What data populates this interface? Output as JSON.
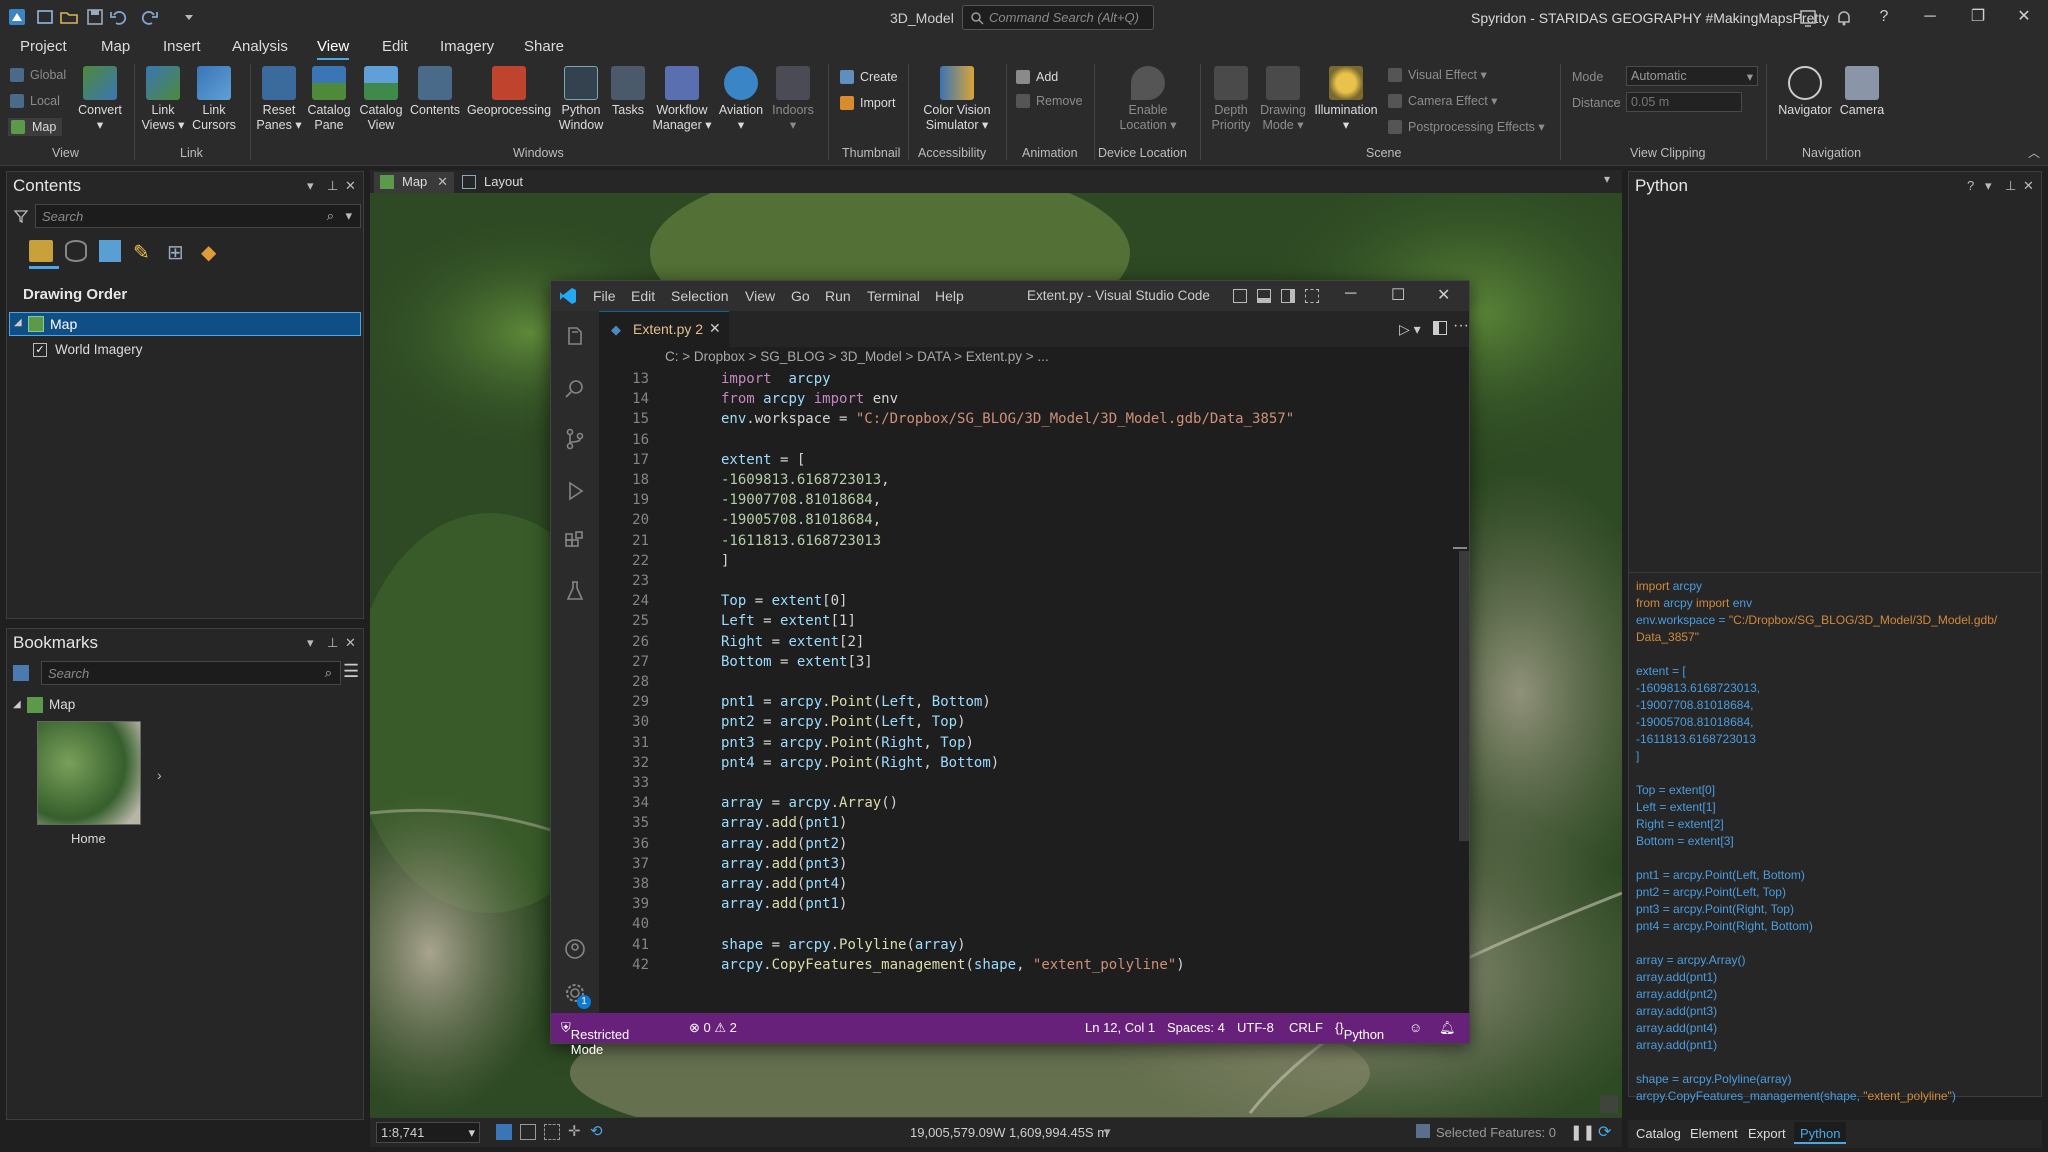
{
  "titlebar": {
    "project": "3D_Model",
    "command_search_placeholder": "Command Search (Alt+Q)",
    "user": "Spyridon - STARIDAS GEOGRAPHY #MakingMapsPretty"
  },
  "ribbon_tabs": [
    "Project",
    "Map",
    "Insert",
    "Analysis",
    "View",
    "Edit",
    "Imagery",
    "Share"
  ],
  "ribbon": {
    "view_group": {
      "global": "Global",
      "local": "Local",
      "map": "Map",
      "convert": "Convert",
      "label": "View"
    },
    "link_group": {
      "link_views": "Link Views",
      "link_cursors": "Link Cursors",
      "label": "Link"
    },
    "windows_group": {
      "reset_panes": "Reset Panes",
      "catalog_pane": "Catalog Pane",
      "catalog_view": "Catalog View",
      "contents": "Contents",
      "geoprocessing": "Geoprocessing",
      "python_window": "Python Window",
      "tasks": "Tasks",
      "workflow_manager": "Workflow Manager",
      "aviation": "Aviation",
      "indoors": "Indoors",
      "label": "Windows"
    },
    "thumbnail_group": {
      "create": "Create",
      "import": "Import",
      "label": "Thumbnail"
    },
    "accessibility_group": {
      "color_vision": "Color Vision Simulator",
      "label": "Accessibility"
    },
    "animation_group": {
      "add": "Add",
      "remove": "Remove",
      "label": "Animation"
    },
    "device_group": {
      "enable_location": "Enable Location",
      "label": "Device Location"
    },
    "scene_group": {
      "depth_priority": "Depth Priority",
      "drawing_mode": "Drawing Mode",
      "illumination": "Illumination",
      "visual_effect": "Visual Effect",
      "camera_effect": "Camera Effect",
      "postprocessing": "Postprocessing Effects",
      "label": "Scene"
    },
    "clipping_group": {
      "mode_label": "Mode",
      "mode_value": "Automatic",
      "distance_label": "Distance",
      "distance_value": "0.05  m",
      "label": "View Clipping"
    },
    "navigation_group": {
      "navigator": "Navigator",
      "camera": "Camera",
      "label": "Navigation"
    }
  },
  "contents": {
    "title": "Contents",
    "search_placeholder": "Search",
    "drawing_order": "Drawing Order",
    "map_item": "Map",
    "layer_item": "World Imagery"
  },
  "bookmarks": {
    "title": "Bookmarks",
    "search_placeholder": "Search",
    "map_item": "Map",
    "bookmark_label": "Home"
  },
  "doc_tabs": [
    "Map",
    "Layout"
  ],
  "vscode": {
    "menu": [
      "File",
      "Edit",
      "Selection",
      "View",
      "Go",
      "Run",
      "Terminal",
      "Help"
    ],
    "title": "Extent.py - Visual Studio Code",
    "tab_label": "Extent.py  2",
    "breadcrumb": "C: > Dropbox > SG_BLOG > 3D_Model > DATA > Extent.py > ...",
    "line_numbers": [
      "13",
      "14",
      "15",
      "16",
      "17",
      "18",
      "19",
      "20",
      "21",
      "22",
      "23",
      "24",
      "25",
      "26",
      "27",
      "28",
      "29",
      "30",
      "31",
      "32",
      "33",
      "34",
      "35",
      "36",
      "37",
      "38",
      "39",
      "40",
      "41",
      "42"
    ],
    "status": {
      "restricted": "Restricted Mode",
      "problems": "⊗ 0 ⚠ 2",
      "position": "Ln 12, Col 1",
      "spaces": "Spaces: 4",
      "encoding": "UTF-8",
      "eol": "CRLF",
      "language": "Python"
    },
    "code_lines": [
      [
        [
          "kw",
          "import"
        ],
        [
          "",
          "  "
        ],
        [
          "va",
          "arcpy"
        ]
      ],
      [
        [
          "kw",
          "from"
        ],
        [
          "",
          " "
        ],
        [
          "va",
          "arcpy"
        ],
        [
          "",
          " "
        ],
        [
          "kw",
          "import"
        ],
        [
          "",
          " env"
        ]
      ],
      [
        [
          "va",
          "env"
        ],
        [
          "",
          ".workspace = "
        ],
        [
          "st",
          "\"C:/Dropbox/SG_BLOG/3D_Model/3D_Model.gdb/Data_3857\""
        ]
      ],
      [],
      [
        [
          "va",
          "extent"
        ],
        [
          "",
          " = ["
        ]
      ],
      [
        [
          "nu",
          "-1609813.6168723013"
        ],
        [
          "",
          ","
        ]
      ],
      [
        [
          "nu",
          "-19007708.81018684"
        ],
        [
          "",
          ","
        ]
      ],
      [
        [
          "nu",
          "-19005708.81018684"
        ],
        [
          "",
          ","
        ]
      ],
      [
        [
          "nu",
          "-1611813.6168723013"
        ]
      ],
      [
        [
          "",
          "]"
        ]
      ],
      [],
      [
        [
          "va",
          "Top"
        ],
        [
          "",
          " = "
        ],
        [
          "va",
          "extent"
        ],
        [
          "",
          "[0]"
        ]
      ],
      [
        [
          "va",
          "Left"
        ],
        [
          "",
          " = "
        ],
        [
          "va",
          "extent"
        ],
        [
          "",
          "[1]"
        ]
      ],
      [
        [
          "va",
          "Right"
        ],
        [
          "",
          " = "
        ],
        [
          "va",
          "extent"
        ],
        [
          "",
          "[2]"
        ]
      ],
      [
        [
          "va",
          "Bottom"
        ],
        [
          "",
          " = "
        ],
        [
          "va",
          "extent"
        ],
        [
          "",
          "[3]"
        ]
      ],
      [],
      [
        [
          "va",
          "pnt1"
        ],
        [
          "",
          " = "
        ],
        [
          "va",
          "arcpy"
        ],
        [
          "",
          "."
        ],
        [
          "fn",
          "Point"
        ],
        [
          "",
          "("
        ],
        [
          "va",
          "Left"
        ],
        [
          "",
          ", "
        ],
        [
          "va",
          "Bottom"
        ],
        [
          "",
          ")"
        ]
      ],
      [
        [
          "va",
          "pnt2"
        ],
        [
          "",
          " = "
        ],
        [
          "va",
          "arcpy"
        ],
        [
          "",
          "."
        ],
        [
          "fn",
          "Point"
        ],
        [
          "",
          "("
        ],
        [
          "va",
          "Left"
        ],
        [
          "",
          ", "
        ],
        [
          "va",
          "Top"
        ],
        [
          "",
          ")"
        ]
      ],
      [
        [
          "va",
          "pnt3"
        ],
        [
          "",
          " = "
        ],
        [
          "va",
          "arcpy"
        ],
        [
          "",
          "."
        ],
        [
          "fn",
          "Point"
        ],
        [
          "",
          "("
        ],
        [
          "va",
          "Right"
        ],
        [
          "",
          ", "
        ],
        [
          "va",
          "Top"
        ],
        [
          "",
          ")"
        ]
      ],
      [
        [
          "va",
          "pnt4"
        ],
        [
          "",
          " = "
        ],
        [
          "va",
          "arcpy"
        ],
        [
          "",
          "."
        ],
        [
          "fn",
          "Point"
        ],
        [
          "",
          "("
        ],
        [
          "va",
          "Right"
        ],
        [
          "",
          ", "
        ],
        [
          "va",
          "Bottom"
        ],
        [
          "",
          ")"
        ]
      ],
      [],
      [
        [
          "va",
          "array"
        ],
        [
          "",
          " = "
        ],
        [
          "va",
          "arcpy"
        ],
        [
          "",
          "."
        ],
        [
          "fn",
          "Array"
        ],
        [
          "",
          "()"
        ]
      ],
      [
        [
          "va",
          "array"
        ],
        [
          "",
          "."
        ],
        [
          "fn",
          "add"
        ],
        [
          "",
          "("
        ],
        [
          "va",
          "pnt1"
        ],
        [
          "",
          ")"
        ]
      ],
      [
        [
          "va",
          "array"
        ],
        [
          "",
          "."
        ],
        [
          "fn",
          "add"
        ],
        [
          "",
          "("
        ],
        [
          "va",
          "pnt2"
        ],
        [
          "",
          ")"
        ]
      ],
      [
        [
          "va",
          "array"
        ],
        [
          "",
          "."
        ],
        [
          "fn",
          "add"
        ],
        [
          "",
          "("
        ],
        [
          "va",
          "pnt3"
        ],
        [
          "",
          ")"
        ]
      ],
      [
        [
          "va",
          "array"
        ],
        [
          "",
          "."
        ],
        [
          "fn",
          "add"
        ],
        [
          "",
          "("
        ],
        [
          "va",
          "pnt4"
        ],
        [
          "",
          ")"
        ]
      ],
      [
        [
          "va",
          "array"
        ],
        [
          "",
          "."
        ],
        [
          "fn",
          "add"
        ],
        [
          "",
          "("
        ],
        [
          "va",
          "pnt1"
        ],
        [
          "",
          ")"
        ]
      ],
      [],
      [
        [
          "va",
          "shape"
        ],
        [
          "",
          " = "
        ],
        [
          "va",
          "arcpy"
        ],
        [
          "",
          "."
        ],
        [
          "fn",
          "Polyline"
        ],
        [
          "",
          "("
        ],
        [
          "va",
          "array"
        ],
        [
          "",
          ")"
        ]
      ],
      [
        [
          "va",
          "arcpy"
        ],
        [
          "",
          "."
        ],
        [
          "fn",
          "CopyFeatures_management"
        ],
        [
          "",
          "("
        ],
        [
          "va",
          "shape"
        ],
        [
          "",
          ", "
        ],
        [
          "st",
          "\"extent_polyline\""
        ],
        [
          "",
          ")"
        ]
      ]
    ]
  },
  "python_pane": {
    "title": "Python",
    "tabs": [
      "Catalog",
      "Element",
      "Export",
      "Python"
    ],
    "output_lines": [
      [
        [
          "pk",
          "import "
        ],
        [
          "pb",
          "arcpy"
        ]
      ],
      [
        [
          "pk",
          "from "
        ],
        [
          "pb",
          "arcpy "
        ],
        [
          "pk",
          "import "
        ],
        [
          "pb",
          "env"
        ]
      ],
      [
        [
          "pb",
          "env.workspace = "
        ],
        [
          "ps",
          "\"C:/Dropbox/SG_BLOG/3D_Model/3D_Model.gdb/"
        ]
      ],
      [
        [
          "ps",
          "Data_3857\""
        ]
      ],
      [],
      [
        [
          "pb",
          "extent = ["
        ]
      ],
      [
        [
          "pb",
          "-1609813.6168723013,"
        ]
      ],
      [
        [
          "pb",
          "-19007708.81018684,"
        ]
      ],
      [
        [
          "pb",
          "-19005708.81018684,"
        ]
      ],
      [
        [
          "pb",
          "-1611813.6168723013"
        ]
      ],
      [
        [
          "pb",
          "]"
        ]
      ],
      [],
      [
        [
          "pb",
          "Top = extent[0]"
        ]
      ],
      [
        [
          "pb",
          "Left = extent[1]"
        ]
      ],
      [
        [
          "pb",
          "Right = extent[2]"
        ]
      ],
      [
        [
          "pb",
          "Bottom = extent[3]"
        ]
      ],
      [],
      [
        [
          "pb",
          "pnt1 = arcpy.Point(Left, Bottom)"
        ]
      ],
      [
        [
          "pb",
          "pnt2 = arcpy.Point(Left, Top)"
        ]
      ],
      [
        [
          "pb",
          "pnt3 = arcpy.Point(Right, Top)"
        ]
      ],
      [
        [
          "pb",
          "pnt4 = arcpy.Point(Right, Bottom)"
        ]
      ],
      [],
      [
        [
          "pb",
          "array = arcpy.Array()"
        ]
      ],
      [
        [
          "pb",
          "array.add(pnt1)"
        ]
      ],
      [
        [
          "pb",
          "array.add(pnt2)"
        ]
      ],
      [
        [
          "pb",
          "array.add(pnt3)"
        ]
      ],
      [
        [
          "pb",
          "array.add(pnt4)"
        ]
      ],
      [
        [
          "pb",
          "array.add(pnt1)"
        ]
      ],
      [],
      [
        [
          "pb",
          "shape = arcpy.Polyline(array)"
        ]
      ],
      [
        [
          "pb",
          "arcpy.CopyFeatures_management(shape, "
        ],
        [
          "ps",
          "\"extent_polyline\""
        ],
        [
          "pb",
          ")"
        ]
      ]
    ]
  },
  "map_status": {
    "scale": "1:8,741",
    "coordinates": "19,005,579.09W 1,609,994.45S m",
    "selected": "Selected Features: 0"
  },
  "colors": {
    "accent": "#4aa8e8",
    "vscode_status": "#68217a",
    "active_layer": "#0f4f86"
  }
}
